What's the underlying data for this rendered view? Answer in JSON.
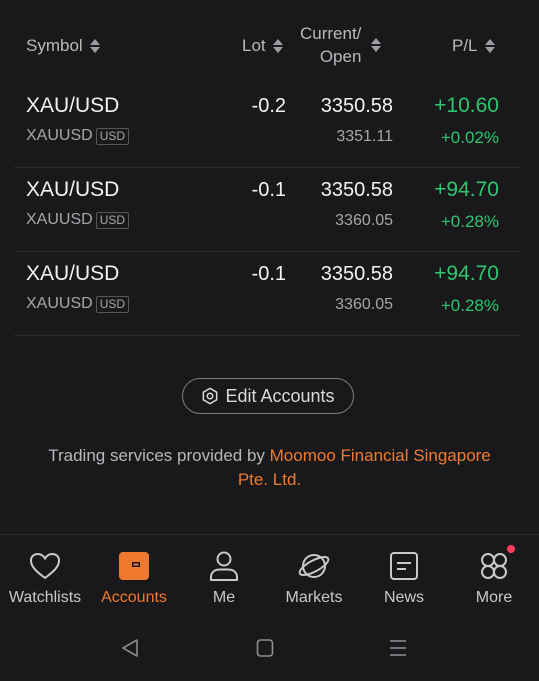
{
  "header": {
    "symbol": "Symbol",
    "lot": "Lot",
    "current_line1": "Current/",
    "current_line2": "Open",
    "pl": "P/L"
  },
  "positions": [
    {
      "symbol": "XAU/USD",
      "code": "XAUUSD",
      "currency": "USD",
      "lot": "-0.2",
      "current": "3350.58",
      "open": "3351.11",
      "pl": "+10.60",
      "pl_pct": "+0.02%"
    },
    {
      "symbol": "XAU/USD",
      "code": "XAUUSD",
      "currency": "USD",
      "lot": "-0.1",
      "current": "3350.58",
      "open": "3360.05",
      "pl": "+94.70",
      "pl_pct": "+0.28%"
    },
    {
      "symbol": "XAU/USD",
      "code": "XAUUSD",
      "currency": "USD",
      "lot": "-0.1",
      "current": "3350.58",
      "open": "3360.05",
      "pl": "+94.70",
      "pl_pct": "+0.28%"
    }
  ],
  "edit_accounts": "Edit Accounts",
  "disclaimer": {
    "prefix": "Trading services provided by ",
    "link_line1": "Moomoo Financial Singapore",
    "link_line2": "Pte. Ltd."
  },
  "nav": {
    "watchlists": "Watchlists",
    "accounts": "Accounts",
    "me": "Me",
    "markets": "Markets",
    "news": "News",
    "more": "More"
  },
  "colors": {
    "background": "#19191b",
    "positive": "#2fc56f",
    "accent": "#ef7a2f",
    "notification_dot": "#ff3d5a"
  },
  "icons": [
    "heart-icon",
    "wallet-icon",
    "person-icon",
    "planet-icon",
    "news-icon",
    "grid-more-icon",
    "back-triangle-icon",
    "home-square-icon",
    "recents-lines-icon",
    "settings-gear-icon",
    "sort-icon"
  ]
}
